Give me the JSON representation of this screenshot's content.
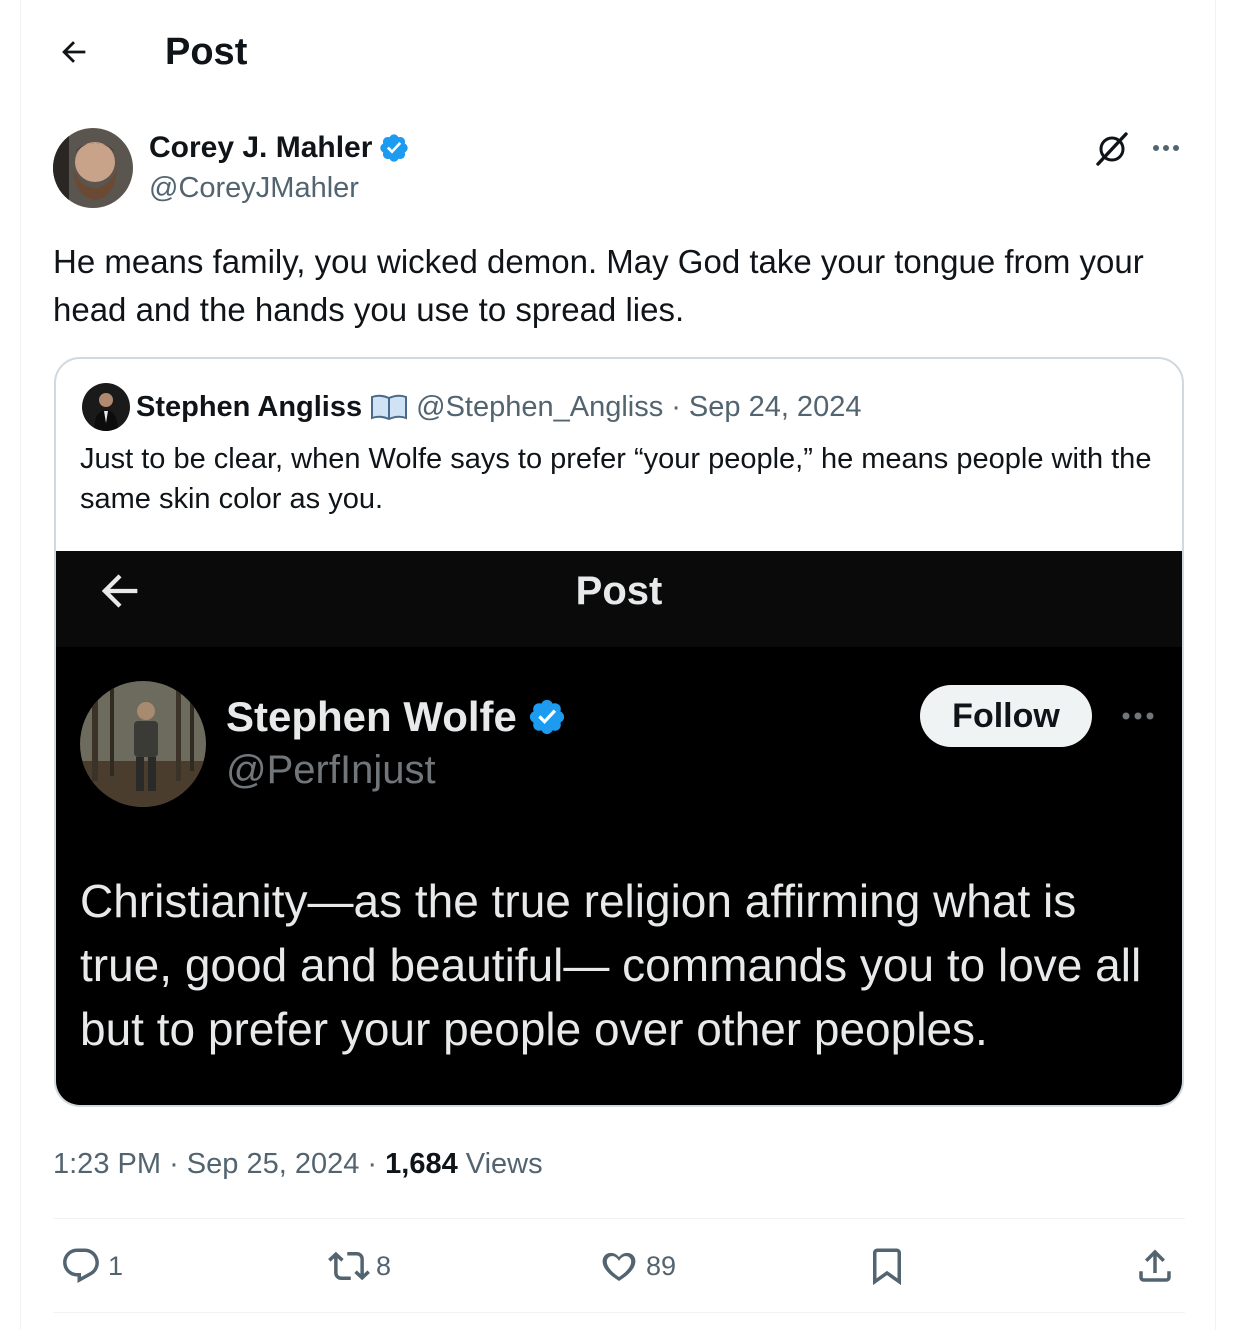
{
  "header": {
    "title": "Post"
  },
  "tweet": {
    "author_name": "Corey J. Mahler",
    "author_handle": "@CoreyJMahler",
    "text": "He means family, you wicked demon. May God take your tongue from your head and the hands you use to spread lies.",
    "time": "1:23 PM",
    "date": "Sep 25, 2024",
    "views_count": "1,684",
    "views_label": "Views",
    "separator": "·"
  },
  "quote": {
    "author_name": "Stephen Angliss",
    "author_handle": "@Stephen_Angliss",
    "separator": "·",
    "date": "Sep 24, 2024",
    "text": "Just to be clear, when Wolfe says to prefer “your people,” he means people with the same skin color as you."
  },
  "screenshot": {
    "title": "Post",
    "author_name": "Stephen Wolfe",
    "author_handle": "@PerfInjust",
    "follow_label": "Follow",
    "text": "Christianity—as the true religion affirming what is true, good and beautiful— commands you to love all but to prefer your people over other peoples."
  },
  "actions": {
    "replies": "1",
    "reposts": "8",
    "likes": "89"
  },
  "colors": {
    "verified": "#1d9bf0",
    "secondary_text": "#536471",
    "divider": "#eff3f4"
  }
}
